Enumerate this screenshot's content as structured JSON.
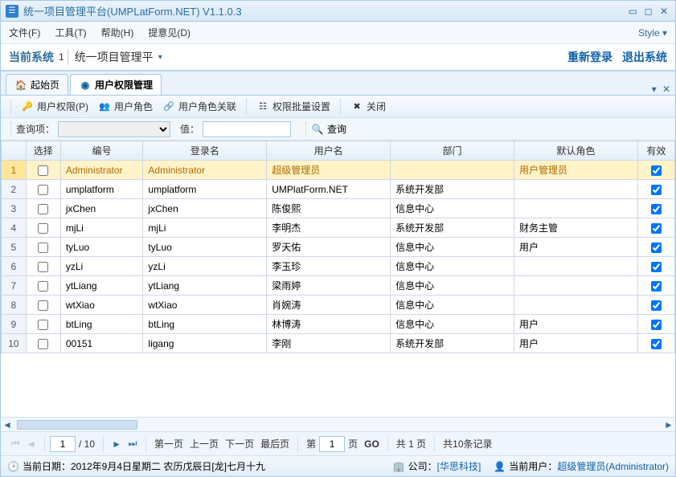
{
  "window": {
    "title": "统一项目管理平台(UMPLatForm.NET) V1.1.0.3"
  },
  "menu": {
    "file": "文件(F)",
    "tools": "工具(T)",
    "help": "帮助(H)",
    "feedback": "提意见(D)",
    "style": "Style ▾"
  },
  "system": {
    "label": "当前系统",
    "index": "1",
    "name": "统一项目管理平",
    "relogin": "重新登录",
    "logout": "退出系统"
  },
  "tabs": {
    "start": "起始页",
    "active": "用户权限管理"
  },
  "toolbar": {
    "user_perm": "用户权限(P)",
    "user_role": "用户角色",
    "user_role_rel": "用户角色关联",
    "perm_batch": "权限批量设置",
    "close": "关闭"
  },
  "search": {
    "query_label": "查询项：",
    "value_label": "值：",
    "query_btn": "查询"
  },
  "grid": {
    "headers": {
      "select": "选择",
      "id": "编号",
      "login": "登录名",
      "username": "用户名",
      "dept": "部门",
      "default_role": "默认角色",
      "valid": "有效"
    },
    "rows": [
      {
        "n": "1",
        "id": "Administrator",
        "login": "Administrator",
        "uname": "超级管理员",
        "dept": "",
        "role": "用户管理员",
        "sel": true
      },
      {
        "n": "2",
        "id": "umplatform",
        "login": "umplatform",
        "uname": "UMPlatForm.NET",
        "dept": "系统开发部",
        "role": ""
      },
      {
        "n": "3",
        "id": "jxChen",
        "login": "jxChen",
        "uname": "陈俊熙",
        "dept": "信息中心",
        "role": ""
      },
      {
        "n": "4",
        "id": "mjLi",
        "login": "mjLi",
        "uname": "李明杰",
        "dept": "系统开发部",
        "role": "财务主管"
      },
      {
        "n": "5",
        "id": "tyLuo",
        "login": "tyLuo",
        "uname": "罗天佑",
        "dept": "信息中心",
        "role": "用户"
      },
      {
        "n": "6",
        "id": "yzLi",
        "login": "yzLi",
        "uname": "李玉珍",
        "dept": "信息中心",
        "role": ""
      },
      {
        "n": "7",
        "id": "ytLiang",
        "login": "ytLiang",
        "uname": "梁雨婷",
        "dept": "信息中心",
        "role": ""
      },
      {
        "n": "8",
        "id": "wtXiao",
        "login": "wtXiao",
        "uname": "肖婉涛",
        "dept": "信息中心",
        "role": ""
      },
      {
        "n": "9",
        "id": "btLing",
        "login": "btLing",
        "uname": "林博涛",
        "dept": "信息中心",
        "role": "用户"
      },
      {
        "n": "10",
        "id": "00151",
        "login": "ligang",
        "uname": "李刚",
        "dept": "系统开发部",
        "role": "用户"
      }
    ]
  },
  "pager": {
    "page_input": "1",
    "total_pages_prefix": "/ ",
    "total_pages": "10",
    "first": "第一页",
    "prev": "上一页",
    "next": "下一页",
    "last": "最后页",
    "jump_label_prefix": "第",
    "jump_value": "1",
    "jump_label_suffix": "页",
    "go": "GO",
    "summary_prefix": "共 ",
    "summary_pages": "1",
    "summary_mid": " 页",
    "records": "共10条记录"
  },
  "status": {
    "date_label": "当前日期：",
    "date_value": "2012年9月4日星期二 农历戊辰日[龙]七月十九",
    "company_label": "公司：",
    "company_value": "[华思科技]",
    "user_label": "当前用户：",
    "user_value": "超级管理员(Administrator)"
  }
}
